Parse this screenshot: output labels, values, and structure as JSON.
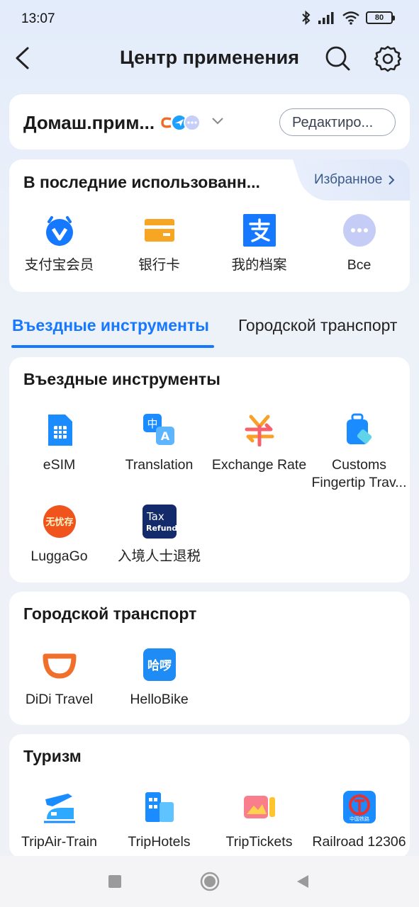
{
  "status": {
    "time": "13:07",
    "battery": "80"
  },
  "header": {
    "title": "Центр применения"
  },
  "home": {
    "title": "Домаш.прим...",
    "edit_label": "Редактиро..."
  },
  "recent": {
    "title": "В последние использованн...",
    "favorites_label": "Избранное",
    "apps": [
      {
        "label": "支付宝会员",
        "icon": "alipay-member-icon"
      },
      {
        "label": "银行卡",
        "icon": "bank-card-icon"
      },
      {
        "label": "我的档案",
        "icon": "alipay-profile-icon"
      },
      {
        "label": "Все",
        "icon": "more-icon"
      }
    ]
  },
  "tabs": [
    {
      "label": "Въездные инструменты",
      "active": true
    },
    {
      "label": "Городской транспорт",
      "active": false
    }
  ],
  "sections": {
    "entry": {
      "title": "Въездные инструменты",
      "apps": [
        {
          "label": "eSIM",
          "icon": "sim-card-icon"
        },
        {
          "label": "Translation",
          "icon": "translation-icon"
        },
        {
          "label": "Exchange Rate",
          "icon": "exchange-rate-icon"
        },
        {
          "label": "Customs Fingertip Trav...",
          "icon": "luggage-icon"
        },
        {
          "label": "LuggaGo",
          "icon": "luggago-icon",
          "icon_text": "无忧存"
        },
        {
          "label": "入境人士退税",
          "icon": "tax-refund-icon",
          "icon_text_1": "Tax",
          "icon_text_2": "Refund"
        }
      ]
    },
    "transport": {
      "title": "Городской транспорт",
      "apps": [
        {
          "label": "DiDi Travel",
          "icon": "didi-icon"
        },
        {
          "label": "HelloBike",
          "icon": "hellobike-icon",
          "icon_text": "哈啰"
        }
      ]
    },
    "tourism": {
      "title": "Туризм",
      "apps": [
        {
          "label": "TripAir-Train",
          "icon": "plane-train-icon"
        },
        {
          "label": "TripHotels",
          "icon": "hotel-icon"
        },
        {
          "label": "TripTickets",
          "icon": "ticket-icon"
        },
        {
          "label": "Railroad 12306",
          "icon": "railway-icon",
          "icon_text": "中国铁路"
        }
      ]
    }
  },
  "colors": {
    "accent": "#1677ff",
    "background": "#edf1f8",
    "card": "#ffffff"
  }
}
